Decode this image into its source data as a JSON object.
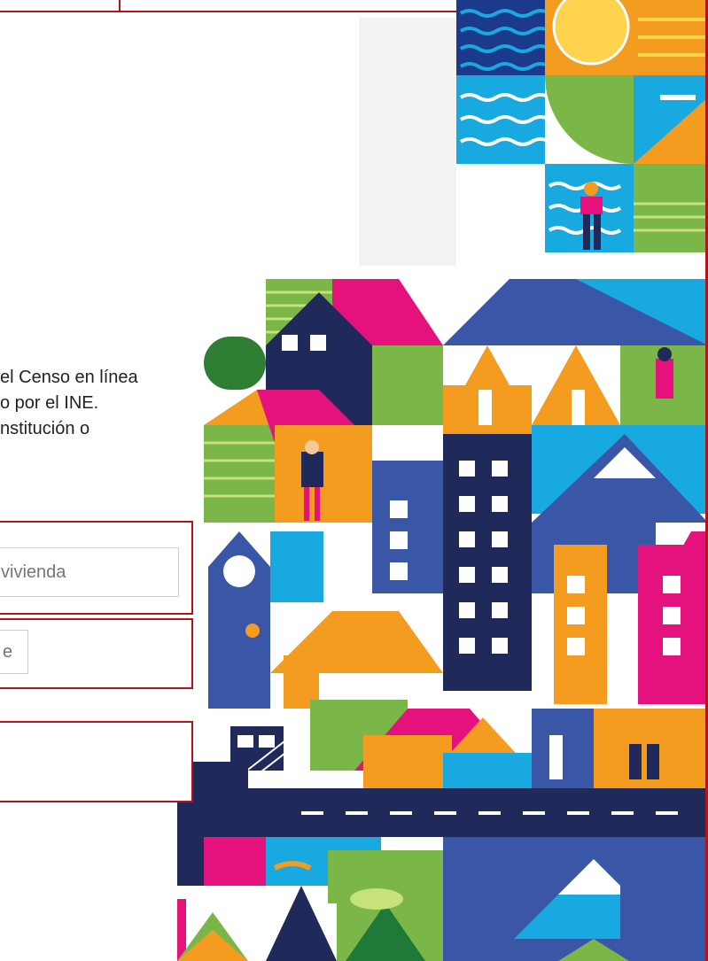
{
  "intro": {
    "line1": "el Censo en línea",
    "line2": "o  por el INE.",
    "line3": "nstitución o"
  },
  "form": {
    "field1_placeholder": "vivienda",
    "field2_placeholder": "e"
  },
  "colors": {
    "accent": "#b5121b",
    "orange": "#f39c1f",
    "magenta": "#e5127d",
    "navy": "#1f2a5a",
    "blue": "#3a57a7",
    "sky": "#19a9e1",
    "green": "#7ab648"
  }
}
